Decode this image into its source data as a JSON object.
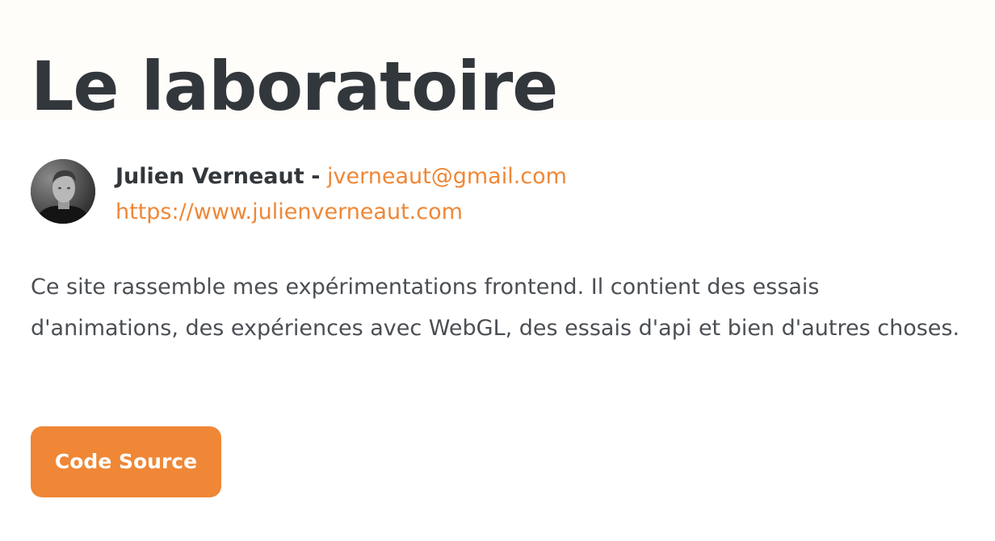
{
  "page": {
    "title": "Le laboratoire"
  },
  "author": {
    "name": "Julien Verneaut",
    "separator": "-",
    "email": "jverneaut@gmail.com",
    "website": "https://www.julienverneaut.com"
  },
  "description": "Ce site rassemble mes expérimentations frontend. Il contient des essais d'animations, des expériences avec WebGL, des essais d'api et bien d'autres choses.",
  "actions": {
    "source_label": "Code Source"
  },
  "colors": {
    "accent": "#ef8736",
    "text": "#32373c",
    "body_text": "#4b4f54"
  }
}
